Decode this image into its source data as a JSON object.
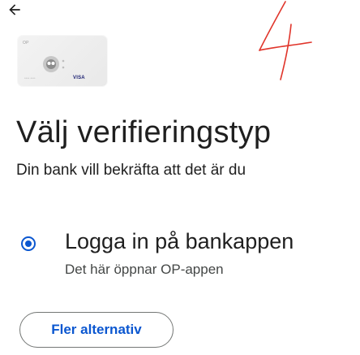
{
  "header": {
    "back_icon": "arrow-left-icon"
  },
  "card": {
    "issuer_tag": "OP",
    "network": "VISA",
    "number_hint": "**** ****",
    "logo_icon": "op-logo-icon"
  },
  "annotation": {
    "text": "4"
  },
  "page": {
    "title": "Välj verifieringstyp",
    "subtitle": "Din bank vill bekräfta att det är du"
  },
  "options": [
    {
      "label": "Logga in på bankappen",
      "description": "Det här öppnar OP-appen",
      "selected": true
    }
  ],
  "actions": {
    "more_label": "Fler alternativ"
  },
  "colors": {
    "accent": "#0b57d0",
    "text": "#1f1f1f",
    "secondary_text": "#444746",
    "outline": "#747775",
    "annotation_ink": "#e0352b"
  }
}
